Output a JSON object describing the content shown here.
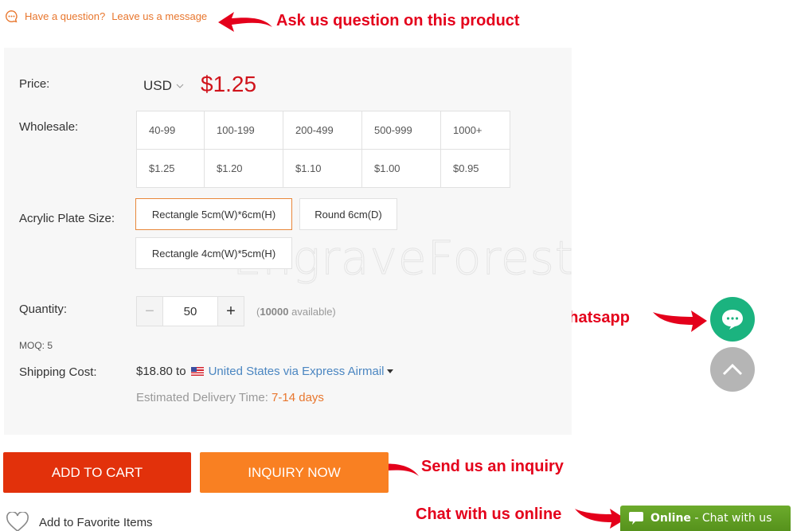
{
  "question_link": {
    "prefix": "Have a question?",
    "link": "Leave us a message"
  },
  "annotations": {
    "ask": "Ask us question on this product",
    "contact": "Contact us on Skype/Whatsapp",
    "inquiry": "Send us an inquiry",
    "chat": "Chat with us online"
  },
  "price": {
    "label": "Price:",
    "currency": "USD",
    "value": "$1.25"
  },
  "wholesale": {
    "label": "Wholesale:",
    "ranges": [
      "40-99",
      "100-199",
      "200-499",
      "500-999",
      "1000+"
    ],
    "prices": [
      "$1.25",
      "$1.20",
      "$1.10",
      "$1.00",
      "$0.95"
    ]
  },
  "plate_size": {
    "label": "Acrylic Plate Size:",
    "options": [
      "Rectangle 5cm(W)*6cm(H)",
      "Round 6cm(D)",
      "Rectangle 4cm(W)*5cm(H)"
    ],
    "selected": "Rectangle 5cm(W)*6cm(H)"
  },
  "watermark": "EngraveForest",
  "quantity": {
    "label": "Quantity:",
    "value": "50",
    "minus": "−",
    "plus": "+",
    "available_open": "(",
    "available_count": "10000",
    "available_suffix": " available)"
  },
  "moq": "MOQ: 5",
  "shipping": {
    "label": "Shipping Cost:",
    "cost": "$18.80 to",
    "method": "United States via Express Airmail",
    "delivery_label": "Estimated Delivery Time: ",
    "delivery_days": "7-14 days"
  },
  "buttons": {
    "add_to_cart": "ADD TO CART",
    "inquiry_now": "INQUIRY NOW"
  },
  "favorite": "Add to Favorite Items",
  "online_chat": {
    "status": "Online",
    "separator": " - ",
    "text": "Chat with us"
  },
  "colors": {
    "accent_orange": "#f98022",
    "cart_red": "#e2310b",
    "price_red": "#d0131b",
    "chat_green": "#1bb37f",
    "online_green": "#6cab2c"
  }
}
